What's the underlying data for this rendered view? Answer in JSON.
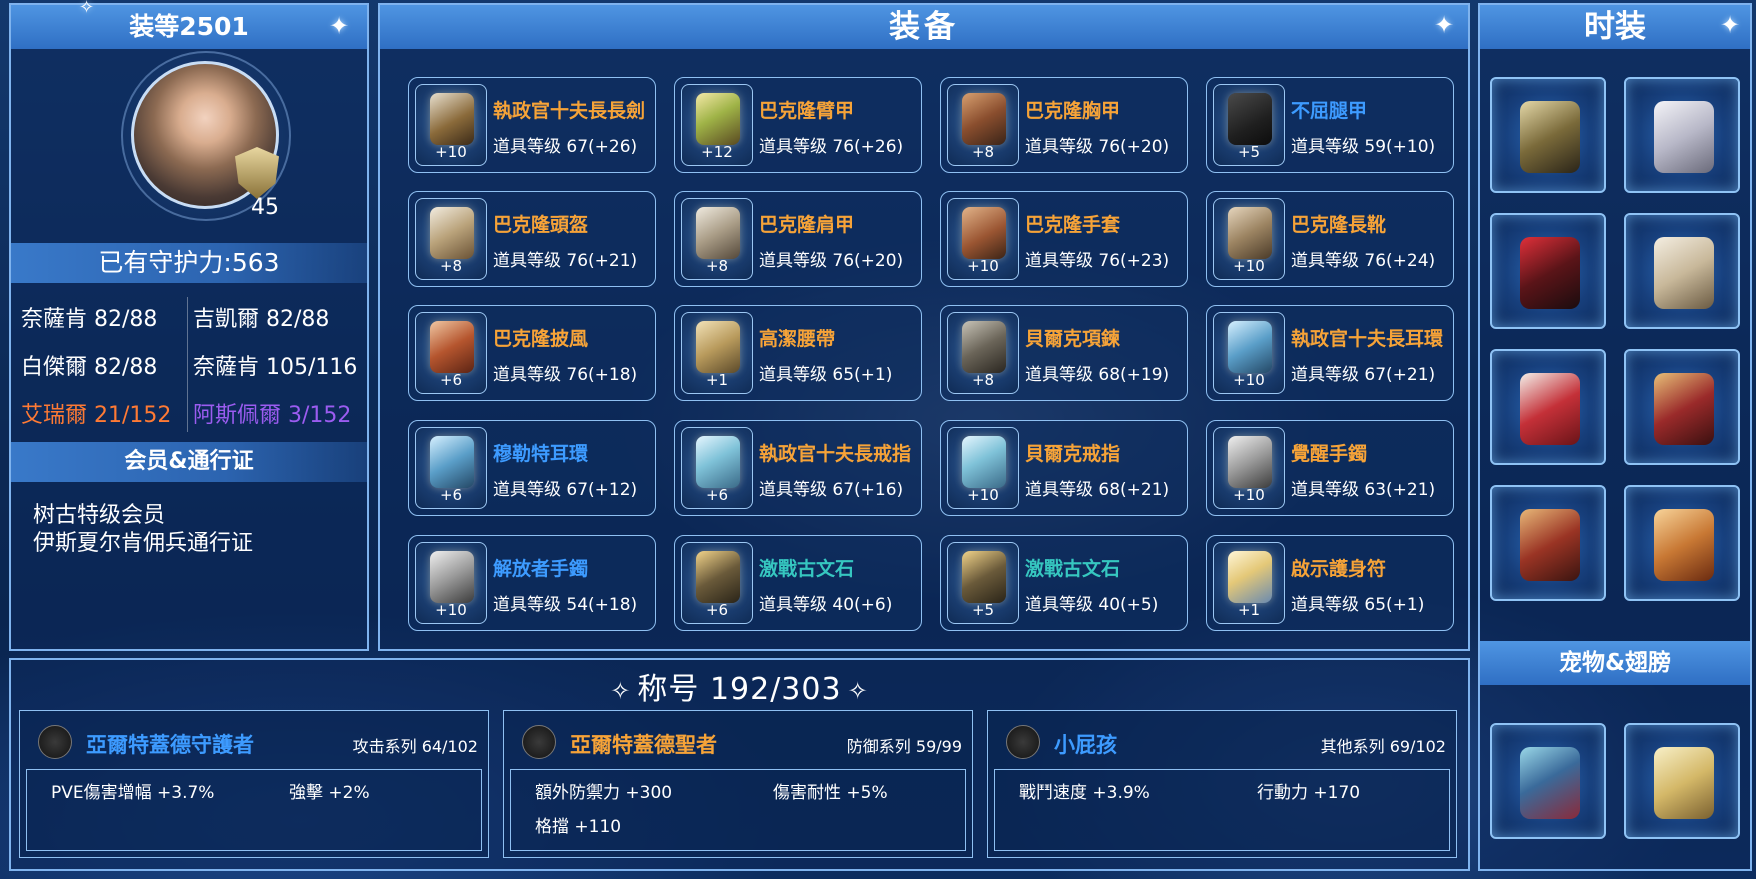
{
  "colors": {
    "orange": "#f6a338",
    "blue": "#3d9bff",
    "teal": "#36c7c0",
    "purple": "#9b5cf0",
    "orange_red": "#ff7a34"
  },
  "left": {
    "gear_score": "装等2501",
    "level": "45",
    "guard_power": "已有守护力:563",
    "stats": [
      {
        "text": "奈薩肯 82/88",
        "color": "#ffffff"
      },
      {
        "text": "吉凱爾 82/88",
        "color": "#ffffff"
      },
      {
        "text": "白傑爾 82/88",
        "color": "#ffffff"
      },
      {
        "text": "奈薩肯 105/116",
        "color": "#ffffff"
      },
      {
        "text": "艾瑞爾 21/152",
        "color": "#ff7a34"
      },
      {
        "text": "阿斯佩爾 3/152",
        "color": "#9b5cf0"
      }
    ],
    "membership_title": "会员&通行证",
    "membership_lines": [
      "树古特级会员",
      "伊斯夏尔肯佣兵通行证"
    ]
  },
  "equipment": {
    "title": "装备",
    "items": [
      {
        "name": "執政官十夫長長劍",
        "level": "道具等级 67(+26)",
        "enh": "+10",
        "color": "#f6a338",
        "icon": "sword-icon"
      },
      {
        "name": "巴克隆臂甲",
        "level": "道具等级 76(+26)",
        "enh": "+12",
        "color": "#f6a338",
        "icon": "bracer-icon"
      },
      {
        "name": "巴克隆胸甲",
        "level": "道具等级 76(+20)",
        "enh": "+8",
        "color": "#f6a338",
        "icon": "chest-armor-icon"
      },
      {
        "name": "不屈腿甲",
        "level": "道具等级 59(+10)",
        "enh": "+5",
        "color": "#3d9bff",
        "icon": "leg-armor-icon"
      },
      {
        "name": "巴克隆頭盔",
        "level": "道具等级 76(+21)",
        "enh": "+8",
        "color": "#f6a338",
        "icon": "helmet-icon"
      },
      {
        "name": "巴克隆肩甲",
        "level": "道具等级 76(+20)",
        "enh": "+8",
        "color": "#f6a338",
        "icon": "shoulder-armor-icon"
      },
      {
        "name": "巴克隆手套",
        "level": "道具等级 76(+23)",
        "enh": "+10",
        "color": "#f6a338",
        "icon": "gloves-icon"
      },
      {
        "name": "巴克隆長靴",
        "level": "道具等级 76(+24)",
        "enh": "+10",
        "color": "#f6a338",
        "icon": "boots-icon"
      },
      {
        "name": "巴克隆披風",
        "level": "道具等级 76(+18)",
        "enh": "+6",
        "color": "#f6a338",
        "icon": "cape-icon"
      },
      {
        "name": "高潔腰帶",
        "level": "道具等级 65(+1)",
        "enh": "+1",
        "color": "#f6a338",
        "icon": "belt-icon"
      },
      {
        "name": "貝爾克項鍊",
        "level": "道具等级 68(+19)",
        "enh": "+8",
        "color": "#f6a338",
        "icon": "necklace-icon"
      },
      {
        "name": "執政官十夫長耳環",
        "level": "道具等级 67(+21)",
        "enh": "+10",
        "color": "#f6a338",
        "icon": "earring-icon"
      },
      {
        "name": "穆勒特耳環",
        "level": "道具等级 67(+12)",
        "enh": "+6",
        "color": "#3d9bff",
        "icon": "earring-icon"
      },
      {
        "name": "執政官十夫長戒指",
        "level": "道具等级 67(+16)",
        "enh": "+6",
        "color": "#f6a338",
        "icon": "ring-icon"
      },
      {
        "name": "貝爾克戒指",
        "level": "道具等级 68(+21)",
        "enh": "+10",
        "color": "#f6a338",
        "icon": "ring-icon"
      },
      {
        "name": "覺醒手鐲",
        "level": "道具等级 63(+21)",
        "enh": "+10",
        "color": "#f6a338",
        "icon": "bracelet-icon"
      },
      {
        "name": "解放者手鐲",
        "level": "道具等级 54(+18)",
        "enh": "+10",
        "color": "#3d9bff",
        "icon": "bracelet-icon"
      },
      {
        "name": "激戰古文石",
        "level": "道具等级 40(+6)",
        "enh": "+6",
        "color": "#36c7c0",
        "icon": "runestone-icon"
      },
      {
        "name": "激戰古文石",
        "level": "道具等级 40(+5)",
        "enh": "+5",
        "color": "#36c7c0",
        "icon": "runestone-icon"
      },
      {
        "name": "啟示護身符",
        "level": "道具等级 65(+1)",
        "enh": "+1",
        "color": "#f6a338",
        "icon": "amulet-icon"
      }
    ]
  },
  "fashion": {
    "title": "时装",
    "costumes": [
      {
        "icon": "costume-weapon-icon"
      },
      {
        "icon": "costume-glove-icon"
      },
      {
        "icon": "costume-hat-icon"
      },
      {
        "icon": "costume-boots-icon"
      },
      {
        "icon": "costume-top-icon"
      },
      {
        "icon": "costume-cloak-icon"
      },
      {
        "icon": "costume-sleeves-icon"
      },
      {
        "icon": "costume-horn-icon"
      }
    ],
    "pet_title": "宠物&翅膀",
    "pets": [
      {
        "icon": "pet-dragon-icon"
      },
      {
        "icon": "wings-icon"
      }
    ]
  },
  "titles": {
    "heading": "称号 192/303",
    "cards": [
      {
        "name": "亞爾特蓋德守護者",
        "color": "#3d9bff",
        "series": "攻击系列 64/102",
        "effects": [
          "PVE傷害增幅 +3.7%",
          "強擊 +2%"
        ]
      },
      {
        "name": "亞爾特蓋德聖者",
        "color": "#f6a338",
        "series": "防御系列 59/99",
        "effects": [
          "額外防禦力 +300",
          "傷害耐性 +5%",
          "格擋 +110"
        ]
      },
      {
        "name": "小屁孩",
        "color": "#3d9bff",
        "series": "其他系列 69/102",
        "effects": [
          "戰鬥速度 +3.9%",
          "行動力 +170"
        ]
      }
    ]
  }
}
